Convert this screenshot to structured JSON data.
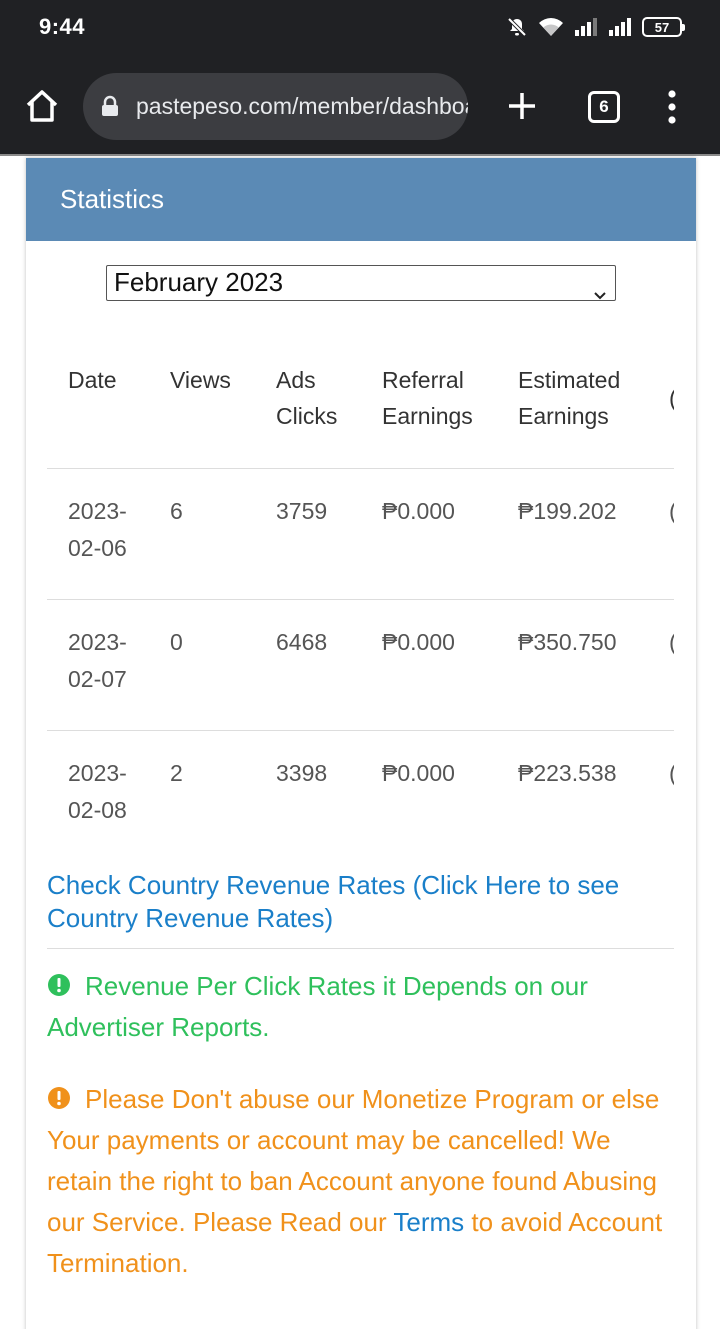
{
  "status_bar": {
    "time": "9:44",
    "battery": "57",
    "icons": [
      "mute-bell-icon",
      "wifi-icon",
      "signal-icon",
      "signal-icon",
      "battery-icon"
    ]
  },
  "browser": {
    "url": "pastepeso.com/member/dashboard",
    "tab_count": "6",
    "icons": [
      "home-icon",
      "lock-icon",
      "plus-icon",
      "tabs-icon",
      "more-vert-icon"
    ]
  },
  "card": {
    "title": "Statistics",
    "month_select": "February 2023"
  },
  "table": {
    "headers": [
      {
        "line1": "",
        "line2": "Date"
      },
      {
        "line1": "",
        "line2": "Views"
      },
      {
        "line1": "Ads",
        "line2": "Clicks"
      },
      {
        "line1": "Referral",
        "line2": "Earnings"
      },
      {
        "line1": "Estimated",
        "line2": "Earnings"
      }
    ],
    "rows": [
      {
        "date_1": "2023-",
        "date_2": "02-06",
        "views": "6",
        "ads_clicks": "3759",
        "referral": "₱0.000",
        "estimated": "₱199.202"
      },
      {
        "date_1": "2023-",
        "date_2": "02-07",
        "views": "0",
        "ads_clicks": "6468",
        "referral": "₱0.000",
        "estimated": "₱350.750"
      },
      {
        "date_1": "2023-",
        "date_2": "02-08",
        "views": "2",
        "ads_clicks": "3398",
        "referral": "₱0.000",
        "estimated": "₱223.538"
      }
    ]
  },
  "rates_link": "Check Country Revenue Rates (Click Here to see Country Revenue Rates)",
  "notice_green": "Revenue Per Click Rates it Depends on our Advertiser Reports.",
  "notice_orange": {
    "text": "Please Don't abuse our Monetize Program or else Your payments or account may be cancelled! We retain the right to ban Account anyone found Abusing our Service. Please Read our",
    "link": "Terms",
    "after": "to avoid Account Termination."
  },
  "colors": {
    "header_bg": "#5b8ab5",
    "link": "#1a7fc9",
    "success": "#2fc05c",
    "warning": "#f0911b",
    "chrome_bg": "#202124"
  }
}
